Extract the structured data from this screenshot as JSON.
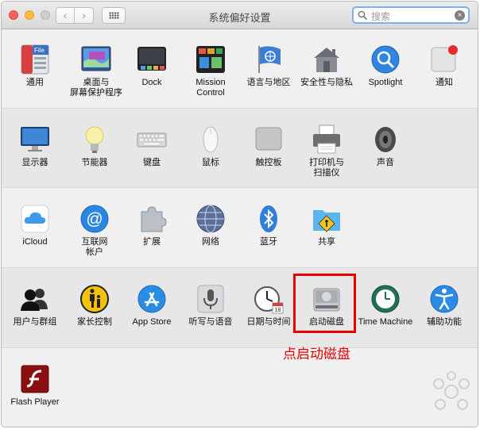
{
  "window": {
    "title": "系统偏好设置"
  },
  "search": {
    "placeholder": "搜索"
  },
  "rows": [
    {
      "items": [
        {
          "id": "general",
          "label": "通用",
          "icon": "general-icon"
        },
        {
          "id": "desktop",
          "label": "桌面与\n屏幕保护程序",
          "icon": "desktop-icon"
        },
        {
          "id": "dock",
          "label": "Dock",
          "icon": "dock-icon"
        },
        {
          "id": "mission-control",
          "label": "Mission\nControl",
          "icon": "mission-control-icon"
        },
        {
          "id": "language",
          "label": "语言与地区",
          "icon": "language-icon"
        },
        {
          "id": "security",
          "label": "安全性与隐私",
          "icon": "security-icon"
        },
        {
          "id": "spotlight",
          "label": "Spotlight",
          "icon": "spotlight-icon"
        },
        {
          "id": "notifications",
          "label": "通知",
          "icon": "notifications-icon"
        }
      ]
    },
    {
      "items": [
        {
          "id": "displays",
          "label": "显示器",
          "icon": "display-icon"
        },
        {
          "id": "energy",
          "label": "节能器",
          "icon": "lightbulb-icon"
        },
        {
          "id": "keyboard",
          "label": "键盘",
          "icon": "keyboard-icon"
        },
        {
          "id": "mouse",
          "label": "鼠标",
          "icon": "mouse-icon"
        },
        {
          "id": "trackpad",
          "label": "触控板",
          "icon": "trackpad-icon"
        },
        {
          "id": "printers",
          "label": "打印机与\n扫描仪",
          "icon": "printer-icon"
        },
        {
          "id": "sound",
          "label": "声音",
          "icon": "speaker-icon"
        }
      ]
    },
    {
      "items": [
        {
          "id": "icloud",
          "label": "iCloud",
          "icon": "icloud-icon"
        },
        {
          "id": "internet-accounts",
          "label": "互联网\n帐户",
          "icon": "internet-accounts-icon"
        },
        {
          "id": "extensions",
          "label": "扩展",
          "icon": "extensions-icon"
        },
        {
          "id": "network",
          "label": "网络",
          "icon": "network-icon"
        },
        {
          "id": "bluetooth",
          "label": "蓝牙",
          "icon": "bluetooth-icon"
        },
        {
          "id": "sharing",
          "label": "共享",
          "icon": "sharing-icon"
        }
      ]
    },
    {
      "items": [
        {
          "id": "users",
          "label": "用户与群组",
          "icon": "users-icon"
        },
        {
          "id": "parental",
          "label": "家长控制",
          "icon": "parental-controls-icon"
        },
        {
          "id": "appstore",
          "label": "App Store",
          "icon": "app-store-icon"
        },
        {
          "id": "dictation",
          "label": "听写与语音",
          "icon": "microphone-icon"
        },
        {
          "id": "datetime",
          "label": "日期与时间",
          "icon": "clock-icon"
        },
        {
          "id": "startup-disk",
          "label": "启动磁盘",
          "icon": "startup-disk-icon"
        },
        {
          "id": "time-machine",
          "label": "Time Machine",
          "icon": "time-machine-icon"
        },
        {
          "id": "accessibility",
          "label": "辅助功能",
          "icon": "accessibility-icon"
        }
      ]
    },
    {
      "items": [
        {
          "id": "flash",
          "label": "Flash Player",
          "icon": "flash-player-icon"
        }
      ]
    }
  ],
  "annotation": {
    "text": "点启动磁盘",
    "color": "#e60000"
  },
  "colors": {
    "accent": "#1a7ee6",
    "highlight": "#e80000"
  }
}
